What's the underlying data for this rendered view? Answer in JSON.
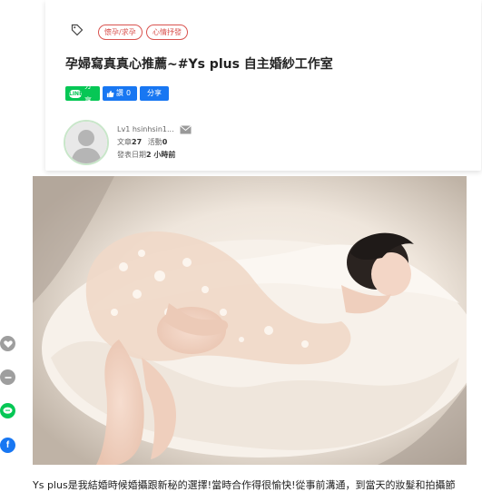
{
  "tags": [
    "懷孕/求孕",
    "心情抒發"
  ],
  "title": "孕婦寫真真心推薦~#Ys plus 自主婚紗工作室",
  "share": {
    "line_label": "分享",
    "like_label": "讚",
    "like_count": "0",
    "fb_share_label": "分享"
  },
  "author": {
    "level": "Lv1",
    "name": "hsinhsin1...",
    "posts_label": "文章",
    "posts": "27",
    "activity_label": "活動",
    "activity": "0",
    "published_label": "發表日期",
    "published": "2 小時前"
  },
  "body_text": "Ys plus是我結婚時候婚攝跟新秘的選擇!當時合作得很愉快!從事前溝通，到當天的妝髮和拍攝節",
  "colors": {
    "tag_red": "#d9534f",
    "line_green": "#06c755",
    "facebook_blue": "#1877f2"
  }
}
